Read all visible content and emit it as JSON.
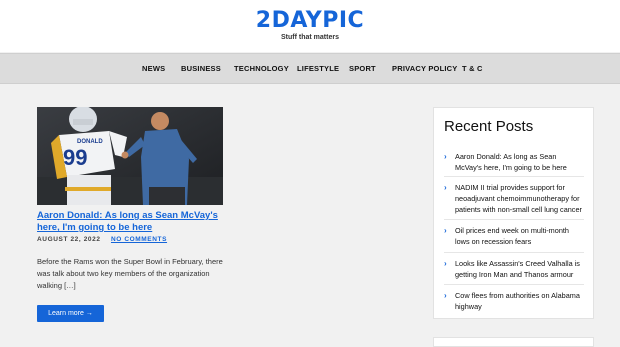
{
  "site": {
    "title": "2DAYPIC",
    "tagline": "Stuff that matters"
  },
  "nav": [
    "NEWS",
    "BUSINESS",
    "TECHNOLOGY",
    "LIFESTYLE",
    "SPORT",
    "PRIVACY POLICY",
    "T & C"
  ],
  "article": {
    "title": "Aaron Donald: As long as Sean McVay's here, I'm going to be here",
    "date": "AUGUST 22, 2022",
    "comments": "NO COMMENTS",
    "excerpt": "Before the Rams won the Super Bowl in February, there was talk about two key members of the organization walking […]",
    "read_more": "Learn more →",
    "jersey_name": "DONALD",
    "jersey_number": "99"
  },
  "sidebar": {
    "title": "Recent Posts",
    "posts": [
      "Aaron Donald: As long as Sean McVay's here, I'm going to be here",
      "NADIM II trial provides support for neoadjuvant chemoimmunotherapy for patients with non-small cell lung cancer",
      "Oil prices end week on multi-month lows on recession fears",
      "Looks like Assassin's Creed Valhalla is getting Iron Man and Thanos armour",
      "Cow flees from authorities on Alabama highway"
    ]
  },
  "colors": {
    "accent": "#1565d8",
    "nav_bg": "#dcdcdc",
    "page_bg": "#f1f1f1"
  }
}
